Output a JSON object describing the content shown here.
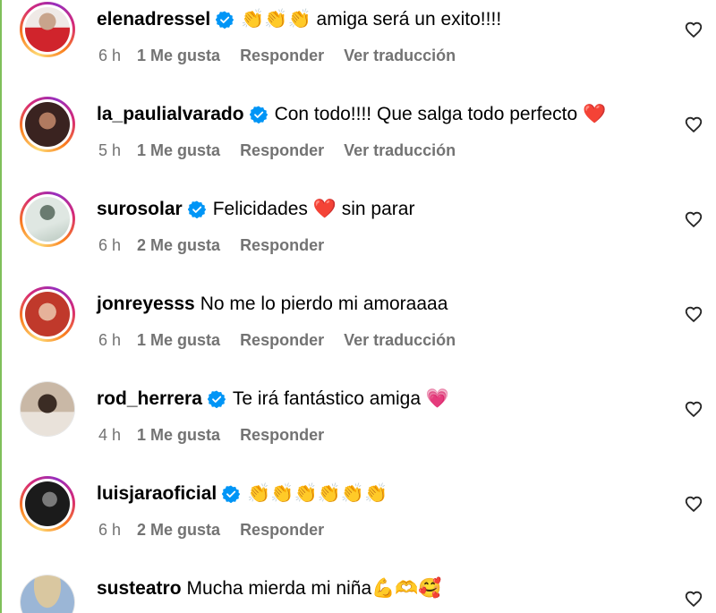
{
  "comments": [
    {
      "username": "elenadressel",
      "verified": true,
      "text": "👏👏👏 amiga será un exito!!!!",
      "time": "6 h",
      "likes": "1 Me gusta",
      "reply": "Responder",
      "translate": "Ver traducción",
      "ring": "story",
      "avatar_colors": [
        "#c8a48c",
        "#d0242c"
      ]
    },
    {
      "username": "la_paulialvarado",
      "verified": true,
      "text": "Con todo!!!! Que salga todo perfecto ❤️",
      "time": "5 h",
      "likes": "1 Me gusta",
      "reply": "Responder",
      "translate": "Ver traducción",
      "ring": "story",
      "avatar_colors": [
        "#3a2320",
        "#b07a60"
      ]
    },
    {
      "username": "surosolar",
      "verified": true,
      "text": "Felicidades ❤️ sin parar",
      "time": "6 h",
      "likes": "2 Me gusta",
      "reply": "Responder",
      "translate": "",
      "ring": "story",
      "avatar_colors": [
        "#dfe7e2",
        "#6a7b70"
      ]
    },
    {
      "username": "jonreyesss",
      "verified": false,
      "text": "No me lo pierdo mi amoraaaa",
      "time": "6 h",
      "likes": "1 Me gusta",
      "reply": "Responder",
      "translate": "Ver traducción",
      "ring": "story",
      "avatar_colors": [
        "#c0392b",
        "#e6b29a"
      ]
    },
    {
      "username": "rod_herrera",
      "verified": true,
      "text": "Te irá fantástico amiga 💗",
      "time": "4 h",
      "likes": "1 Me gusta",
      "reply": "Responder",
      "translate": "",
      "ring": "plain",
      "avatar_colors": [
        "#c9b8a6",
        "#3b2c24"
      ]
    },
    {
      "username": "luisjaraoficial",
      "verified": true,
      "text": "👏👏👏👏👏👏",
      "time": "6 h",
      "likes": "2 Me gusta",
      "reply": "Responder",
      "translate": "",
      "ring": "story",
      "avatar_colors": [
        "#1b1b1b",
        "#7a7a7a"
      ]
    },
    {
      "username": "susteatro",
      "verified": false,
      "text": "Mucha mierda mi niña💪🫶🥰",
      "time": "",
      "likes": "",
      "reply": "",
      "translate": "",
      "ring": "plain",
      "avatar_colors": [
        "#9bb6d6",
        "#d9c7a0"
      ]
    }
  ],
  "colors": {
    "verified": "#0095f6",
    "meta": "#737373"
  },
  "icons": {
    "verified": "verified-badge-icon",
    "like": "heart-outline-icon"
  }
}
